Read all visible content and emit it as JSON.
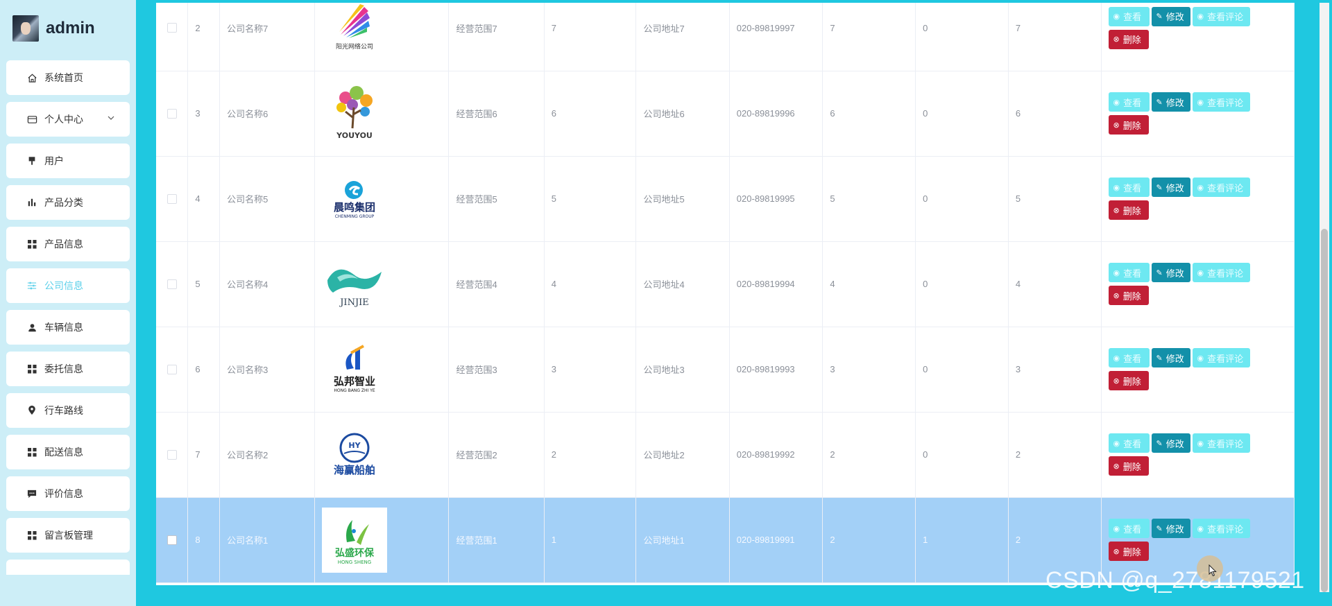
{
  "brand": {
    "name": "admin"
  },
  "sidebar": {
    "items": [
      {
        "label": "系统首页",
        "icon": "home-icon"
      },
      {
        "label": "个人中心",
        "icon": "id-card-icon",
        "has_submenu": true
      },
      {
        "label": "用户",
        "icon": "pin-icon"
      },
      {
        "label": "产品分类",
        "icon": "bar-chart-icon"
      },
      {
        "label": "产品信息",
        "icon": "grid-icon"
      },
      {
        "label": "公司信息",
        "icon": "sliders-icon",
        "active": true
      },
      {
        "label": "车辆信息",
        "icon": "user-icon"
      },
      {
        "label": "委托信息",
        "icon": "grid-icon"
      },
      {
        "label": "行车路线",
        "icon": "location-icon"
      },
      {
        "label": "配送信息",
        "icon": "grid-icon"
      },
      {
        "label": "评价信息",
        "icon": "chat-icon"
      },
      {
        "label": "留言板管理",
        "icon": "grid-icon"
      }
    ]
  },
  "table": {
    "actions": {
      "view": "查看",
      "edit": "修改",
      "comments": "查看评论",
      "delete": "删除"
    },
    "rows": [
      {
        "index": "2",
        "name": "公司名称7",
        "logo": "logo-colorful-feathers",
        "logo_text": "阳光网络公司",
        "scope": "经营范围7",
        "c1": "7",
        "address": "公司地址7",
        "phone": "020-89819997",
        "c2": "7",
        "c3": "0",
        "c4": "7",
        "selected": false
      },
      {
        "index": "3",
        "name": "公司名称6",
        "logo": "logo-youyou-tree",
        "logo_text": "YOUYOU",
        "scope": "经营范围6",
        "c1": "6",
        "address": "公司地址6",
        "phone": "020-89819996",
        "c2": "6",
        "c3": "0",
        "c4": "6",
        "selected": false
      },
      {
        "index": "4",
        "name": "公司名称5",
        "logo": "logo-chenming",
        "logo_text": "晨鸣集团",
        "logo_sub": "CHENMING GROUP",
        "scope": "经营范围5",
        "c1": "5",
        "address": "公司地址5",
        "phone": "020-89819995",
        "c2": "5",
        "c3": "0",
        "c4": "5",
        "selected": false
      },
      {
        "index": "5",
        "name": "公司名称4",
        "logo": "logo-jinjie-wave",
        "logo_text": "JINJIE",
        "scope": "经营范围4",
        "c1": "4",
        "address": "公司地址4",
        "phone": "020-89819994",
        "c2": "4",
        "c3": "0",
        "c4": "4",
        "selected": false
      },
      {
        "index": "6",
        "name": "公司名称3",
        "logo": "logo-hongbang",
        "logo_text": "弘邦智业",
        "logo_sub": "HONG BANG ZHI YE",
        "scope": "经营范围3",
        "c1": "3",
        "address": "公司地址3",
        "phone": "020-89819993",
        "c2": "3",
        "c3": "0",
        "c4": "3",
        "selected": false
      },
      {
        "index": "7",
        "name": "公司名称2",
        "logo": "logo-haiying-ship",
        "logo_text": "海赢船舶",
        "scope": "经营范围2",
        "c1": "2",
        "address": "公司地址2",
        "phone": "020-89819992",
        "c2": "2",
        "c3": "0",
        "c4": "2",
        "selected": false
      },
      {
        "index": "8",
        "name": "公司名称1",
        "logo": "logo-hongsheng",
        "logo_text": "弘盛环保",
        "logo_sub": "HONG SHENG",
        "scope": "经营范围1",
        "c1": "1",
        "address": "公司地址1",
        "phone": "020-89819991",
        "c2": "2",
        "c3": "1",
        "c4": "2",
        "selected": true
      }
    ]
  },
  "watermark": "CSDN @q_2781179521",
  "colors": {
    "sidebar_bg": "#cdeef7",
    "main_bg": "#1fc8e0",
    "active": "#5cd0ea",
    "view_button": "#6de8f1",
    "edit_button": "#1390a9",
    "delete_button": "#c11f36",
    "selected_row": "#a3d0f7"
  }
}
